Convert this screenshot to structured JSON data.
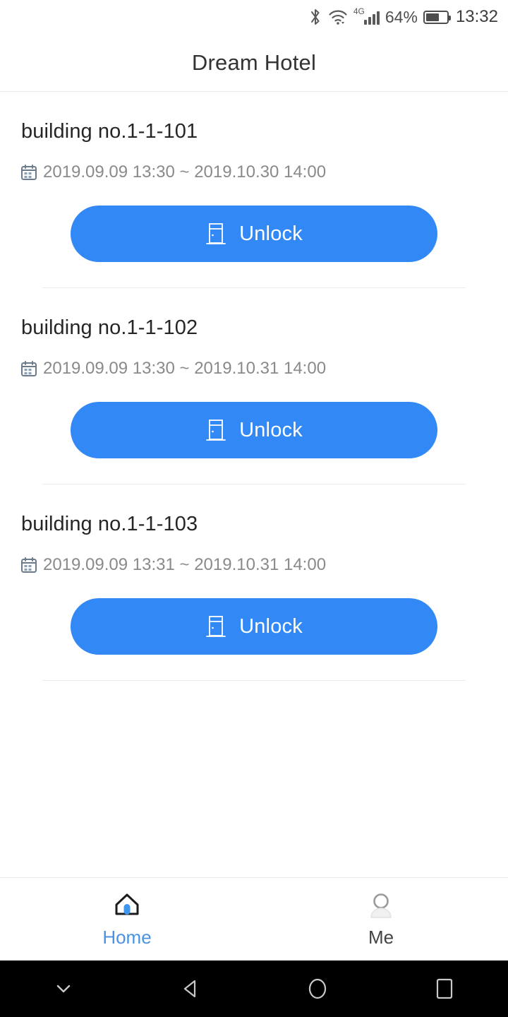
{
  "status_bar": {
    "bluetooth_icon": "bluetooth-icon",
    "wifi_icon": "wifi-icon",
    "network_type": "4G",
    "signal_icon": "signal-bars-icon",
    "battery_percent": "64%",
    "battery_icon": "battery-icon",
    "battery_level": 64,
    "time": "13:32"
  },
  "header": {
    "title": "Dream Hotel"
  },
  "rooms": [
    {
      "name": "building no.1-1-101",
      "calendar_icon": "calendar-icon",
      "date_range": "2019.09.09 13:30 ~ 2019.10.30 14:00",
      "unlock_label": "Unlock",
      "unlock_icon": "door-icon"
    },
    {
      "name": "building no.1-1-102",
      "calendar_icon": "calendar-icon",
      "date_range": "2019.09.09 13:30 ~ 2019.10.31 14:00",
      "unlock_label": "Unlock",
      "unlock_icon": "door-icon"
    },
    {
      "name": "building no.1-1-103",
      "calendar_icon": "calendar-icon",
      "date_range": "2019.09.09 13:31 ~ 2019.10.31 14:00",
      "unlock_label": "Unlock",
      "unlock_icon": "door-icon"
    }
  ],
  "tab_bar": {
    "tabs": [
      {
        "label": "Home",
        "icon": "home-icon",
        "active": true
      },
      {
        "label": "Me",
        "icon": "person-icon",
        "active": false
      }
    ]
  },
  "nav_bar": {
    "buttons": [
      {
        "icon": "chevron-down-icon"
      },
      {
        "icon": "back-triangle-icon"
      },
      {
        "icon": "home-circle-icon"
      },
      {
        "icon": "recents-square-icon"
      }
    ]
  },
  "colors": {
    "accent_blue": "#3288f5",
    "tab_active_blue": "#4b93e0",
    "title_text": "#333333",
    "secondary_text": "#8a8a8a",
    "divider": "#ececec",
    "nav_background": "#000000"
  }
}
